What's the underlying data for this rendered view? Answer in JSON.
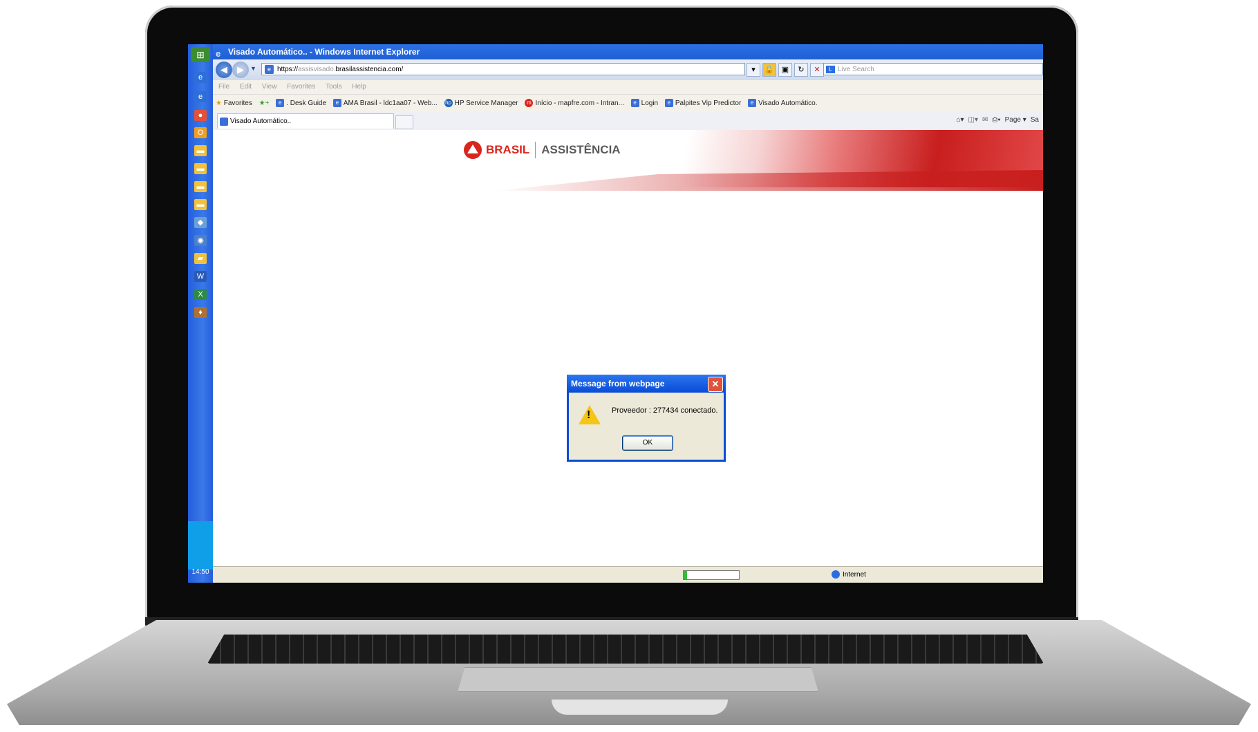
{
  "window": {
    "title": "Visado Automático.. - Windows Internet Explorer"
  },
  "address_bar": {
    "url_prefix": "https://",
    "url_dim": "assisvisado.",
    "url_domain": "brasilassistencia.com/",
    "search_placeholder": "Live Search"
  },
  "menu": [
    "File",
    "Edit",
    "View",
    "Favorites",
    "Tools",
    "Help"
  ],
  "favorites": {
    "label": "Favorites",
    "items": [
      ". Desk Guide",
      "AMA Brasil - ldc1aa07 - Web...",
      "HP Service Manager",
      "Início - mapfre.com - Intran...",
      "Login",
      "Palpites Vip Predictor",
      "Visado Automático."
    ]
  },
  "tab": {
    "label": "Visado Automático.."
  },
  "command_bar": {
    "page_label": "Page",
    "safety_label": "Sa"
  },
  "banner": {
    "brand_left": "BRASIL",
    "brand_right": "ASSISTÊNCIA"
  },
  "dialog": {
    "title": "Message from webpage",
    "message": "Proveedor : 277434 conectado.",
    "ok_label": "OK",
    "close_glyph": "✕"
  },
  "status_bar": {
    "zone": "Internet",
    "progress_fraction": 0.06
  },
  "taskbar": {
    "clock": "14:50"
  }
}
